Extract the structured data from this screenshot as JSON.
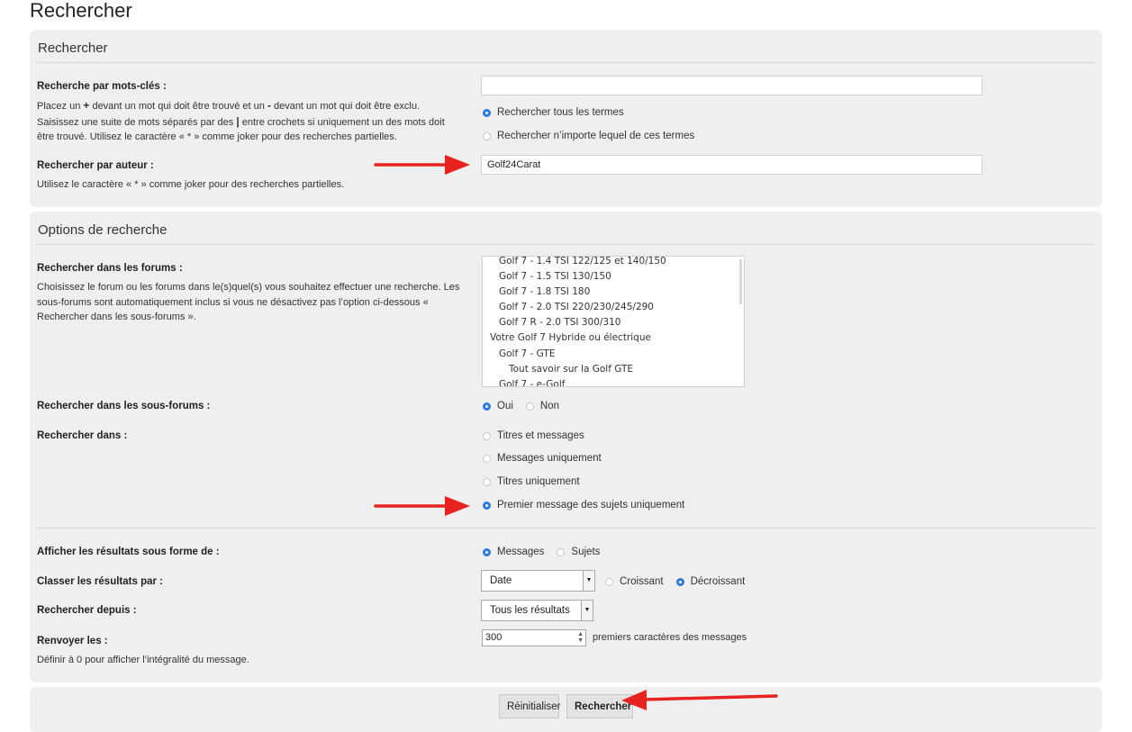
{
  "page_title": "Rechercher",
  "search_panel": {
    "title": "Rechercher",
    "keywords": {
      "label": "Recherche par mots-clés :",
      "desc_p1": "Placez un ",
      "desc_plus": "+",
      "desc_p2": " devant un mot qui doit être trouvé et un ",
      "desc_minus": "-",
      "desc_p3": " devant un mot qui doit être exclu. Saisissez une suite de mots séparés par des ",
      "desc_pipe": "|",
      "desc_p4": " entre crochets si uniquement un des mots doit être trouvé. Utilisez le caractère « * » comme joker pour des recherches partielles.",
      "value": "",
      "options": [
        "Rechercher tous les termes",
        "Rechercher n’importe lequel de ces termes"
      ]
    },
    "author": {
      "label": "Rechercher par auteur :",
      "desc": "Utilisez le caractère « * » comme joker pour des recherches partielles.",
      "value": "Golf24Carat"
    }
  },
  "options_panel": {
    "title": "Options de recherche",
    "forums": {
      "label": "Rechercher dans les forums :",
      "desc": "Choisissez le forum ou les forums dans le(s)quel(s) vous souhaitez effectuer une recherche. Les sous-forums sont automatiquement inclus si vous ne désactivez pas l’option ci-dessous « Rechercher dans les sous-forums ».",
      "items": [
        "Golf 7 - 1.4 TSI 122/125 et 140/150",
        "Golf 7 - 1.5 TSI 130/150",
        "Golf 7 - 1.8 TSI 180",
        "Golf 7 - 2.0 TSI 220/230/245/290",
        "Golf 7 R - 2.0 TSI 300/310",
        "Votre Golf 7 Hybride ou électrique",
        "Golf 7 - GTE",
        "Tout savoir sur la Golf GTE",
        "Golf 7 - e-Golf"
      ]
    },
    "subforums": {
      "label": "Rechercher dans les sous-forums :",
      "yes": "Oui",
      "no": "Non"
    },
    "search_in": {
      "label": "Rechercher dans :",
      "options": [
        "Titres et messages",
        "Messages uniquement",
        "Titres uniquement",
        "Premier message des sujets uniquement"
      ]
    },
    "display": {
      "label": "Afficher les résultats sous forme de :",
      "messages": "Messages",
      "topics": "Sujets"
    },
    "sort": {
      "label": "Classer les résultats par :",
      "field": "Date",
      "asc": "Croissant",
      "desc": "Décroissant"
    },
    "since": {
      "label": "Rechercher depuis :",
      "value": "Tous les résultats"
    },
    "return": {
      "label": "Renvoyer les :",
      "value": "300",
      "suffix": "premiers caractères des messages",
      "desc": "Définir à 0 pour afficher l’intégralité du message."
    }
  },
  "buttons": {
    "reset": "Réinitialiser",
    "search": "Rechercher"
  },
  "colors": {
    "arrow": "#e8231f",
    "radio_selected": "#2a7ae2",
    "panel_bg": "#efefef"
  }
}
